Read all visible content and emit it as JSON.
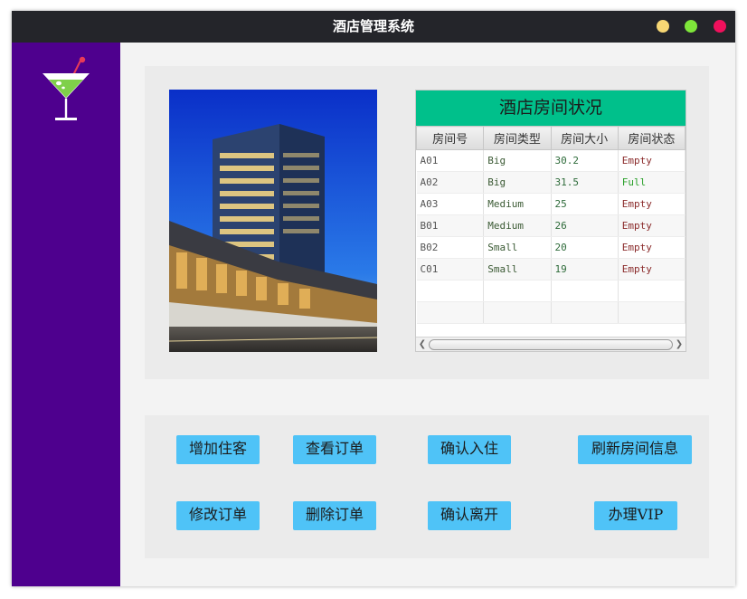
{
  "window": {
    "title": "酒店管理系统",
    "controls": [
      {
        "name": "minimize",
        "color": "#f7d774"
      },
      {
        "name": "maximize",
        "color": "#7ee63a"
      },
      {
        "name": "close",
        "color": "#f0105c"
      }
    ]
  },
  "colors": {
    "titlebar": "#24252a",
    "sidebar": "#4e008e",
    "table_header": "#00c08b",
    "button": "#4fc3f7",
    "status_empty": "#8a2a2a",
    "status_full": "#2aa02a"
  },
  "sidebar": {
    "logo_icon": "cocktail-glass-icon"
  },
  "room_table": {
    "title": "酒店房间状况",
    "columns": [
      "房间号",
      "房间类型",
      "房间大小",
      "房间状态"
    ],
    "rows": [
      [
        "A01",
        "Big",
        "30.2",
        "Empty"
      ],
      [
        "A02",
        "Big",
        "31.5",
        "Full"
      ],
      [
        "A03",
        "Medium",
        "25",
        "Empty"
      ],
      [
        "B01",
        "Medium",
        "26",
        "Empty"
      ],
      [
        "B02",
        "Small",
        "20",
        "Empty"
      ],
      [
        "C01",
        "Small",
        "19",
        "Empty"
      ]
    ]
  },
  "buttons": {
    "add_guest": "增加住客",
    "view_orders": "查看订单",
    "confirm_checkin": "确认入住",
    "refresh_rooms": "刷新房间信息",
    "edit_order": "修改订单",
    "delete_order": "删除订单",
    "confirm_checkout": "确认离开",
    "vip": "办理VIP"
  }
}
